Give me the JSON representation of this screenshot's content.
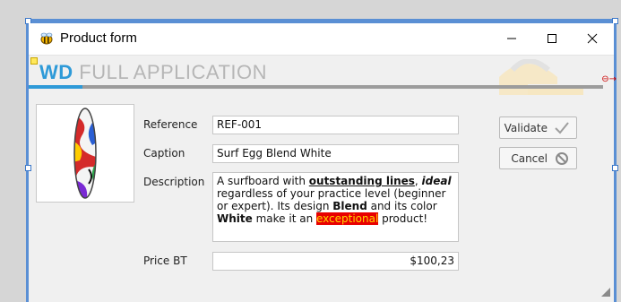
{
  "window": {
    "title": "Product form",
    "icons": {
      "app": "bee-app-icon",
      "minimize": "minimize-icon",
      "maximize": "maximize-icon",
      "close": "close-icon"
    }
  },
  "header": {
    "brand_wd": "WD",
    "brand_rest": " FULL APPLICATION"
  },
  "colors": {
    "accent": "#2e9ad8",
    "bar": "#9c9c9c",
    "highlight_bg": "#e80000",
    "highlight_fg": "#ffd400"
  },
  "form": {
    "reference": {
      "label": "Reference",
      "value": "REF-001"
    },
    "caption": {
      "label": "Caption",
      "value": "Surf Egg Blend White"
    },
    "description": {
      "label": "Description",
      "p1": "A surfboard with ",
      "b1": "outstanding lines",
      "p2": ", ",
      "b2": "ideal",
      "p3": " regardless of your practice level (beginner or expert). Its design ",
      "b3": "Blend",
      "p4": " and its color ",
      "b4": "White",
      "p5": " make it an ",
      "hl": "exceptional",
      "p6": " product!"
    },
    "price": {
      "label": "Price BT",
      "value": "$100,23"
    }
  },
  "buttons": {
    "validate": {
      "label": "Validate",
      "icon": "check-icon"
    },
    "cancel": {
      "label": "Cancel",
      "icon": "cancel-circle-icon"
    }
  }
}
